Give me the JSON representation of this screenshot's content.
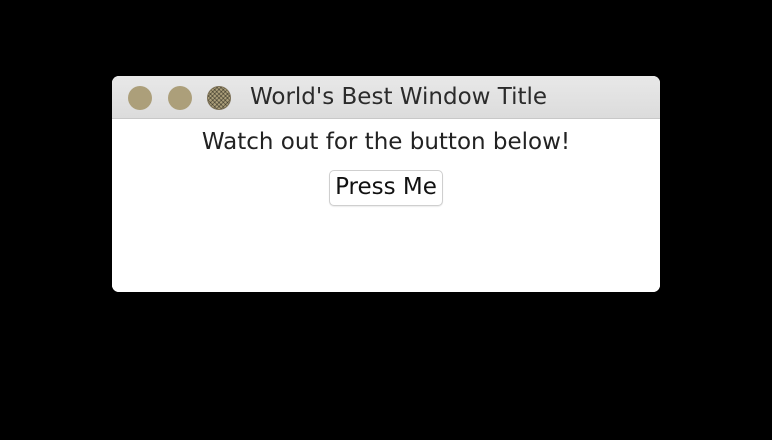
{
  "window": {
    "title": "World's Best Window Title",
    "controls": {
      "close": "close-icon",
      "minimize": "minimize-icon",
      "zoom": "zoom-icon",
      "color": "#ac9f7a"
    }
  },
  "content": {
    "message": "Watch out for the button below!",
    "button_label": "Press Me"
  }
}
